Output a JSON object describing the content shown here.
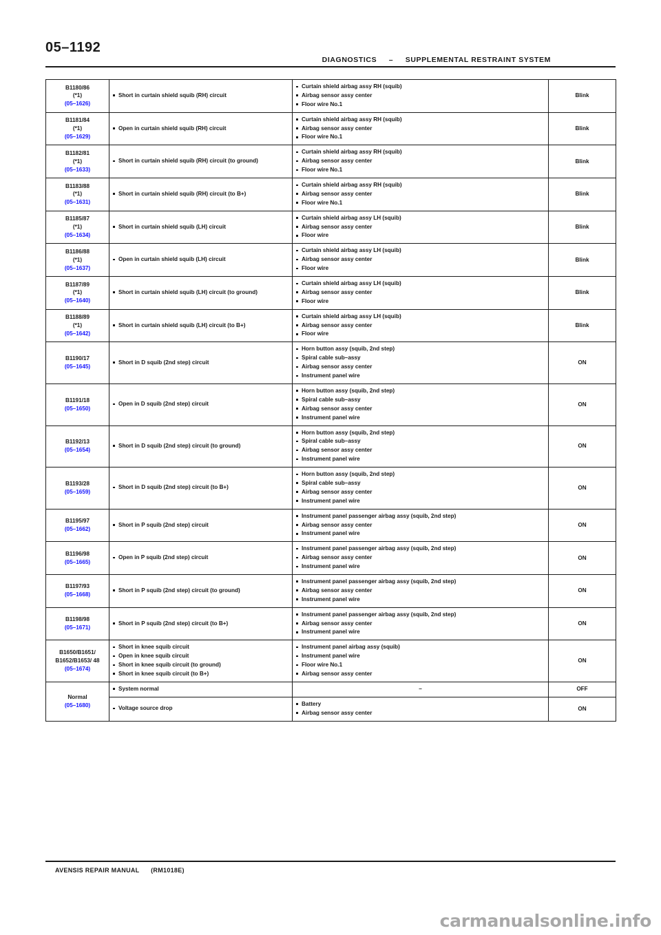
{
  "header": {
    "page_number": "05–1192",
    "section": "DIAGNOSTICS",
    "separator": "–",
    "system": "SUPPLEMENTAL RESTRAINT SYSTEM"
  },
  "footer": {
    "manual": "AVENSIS REPAIR MANUAL",
    "code": "(RM1018E)"
  },
  "watermark": "carmanualsonline.info",
  "table": {
    "rows": [
      {
        "dtc": "B1180/86",
        "note": "(*1)",
        "ref": "(05–1626)",
        "trouble": [
          "Short in curtain shield squib (RH) circuit"
        ],
        "suspect": [
          "Curtain shield airbag assy RH (squib)",
          "Airbag sensor assy center",
          "Floor wire No.1"
        ],
        "warning": "Blink"
      },
      {
        "dtc": "B1181/84",
        "note": "(*1)",
        "ref": "(05–1629)",
        "trouble": [
          "Open in curtain shield squib (RH) circuit"
        ],
        "suspect": [
          "Curtain shield airbag assy RH (squib)",
          "Airbag sensor assy center",
          "Floor wire No.1"
        ],
        "warning": "Blink"
      },
      {
        "dtc": "B1182/81",
        "note": "(*1)",
        "ref": "(05–1633)",
        "trouble": [
          "Short in curtain shield squib (RH) circuit (to ground)"
        ],
        "suspect": [
          "Curtain shield airbag assy RH (squib)",
          "Airbag sensor assy center",
          "Floor wire No.1"
        ],
        "warning": "Blink"
      },
      {
        "dtc": "B1183/88",
        "note": "(*1)",
        "ref": "(05–1631)",
        "trouble": [
          "Short in curtain shield squib (RH) circuit (to B+)"
        ],
        "suspect": [
          "Curtain shield airbag assy RH (squib)",
          "Airbag sensor assy center",
          "Floor wire No.1"
        ],
        "warning": "Blink"
      },
      {
        "dtc": "B1185/87",
        "note": "(*1)",
        "ref": "(05–1634)",
        "trouble": [
          "Short in curtain shield squib (LH) circuit"
        ],
        "suspect": [
          "Curtain shield airbag assy LH (squib)",
          "Airbag sensor assy center",
          "Floor wire"
        ],
        "warning": "Blink"
      },
      {
        "dtc": "B1186/88",
        "note": "(*1)",
        "ref": "(05–1637)",
        "trouble": [
          "Open in curtain shield squib (LH) circuit"
        ],
        "suspect": [
          "Curtain shield airbag assy LH (squib)",
          "Airbag sensor assy center",
          "Floor wire"
        ],
        "warning": "Blink"
      },
      {
        "dtc": "B1187/89",
        "note": "(*1)",
        "ref": "(05–1640)",
        "trouble": [
          "Short in curtain shield squib (LH) circuit (to ground)"
        ],
        "suspect": [
          "Curtain shield airbag assy LH (squib)",
          "Airbag sensor assy center",
          "Floor wire"
        ],
        "warning": "Blink"
      },
      {
        "dtc": "B1188/89",
        "note": "(*1)",
        "ref": "(05–1642)",
        "trouble": [
          "Short in curtain shield squib (LH) circuit (to B+)"
        ],
        "suspect": [
          "Curtain shield airbag assy LH (squib)",
          "Airbag sensor assy center",
          "Floor wire"
        ],
        "warning": "Blink"
      },
      {
        "dtc": "B1190/17",
        "note": "",
        "ref": "(05–1645)",
        "trouble": [
          "Short in D squib (2nd step) circuit"
        ],
        "suspect": [
          "Horn button assy (squib, 2nd step)",
          "Spiral cable sub–assy",
          "Airbag sensor assy center",
          "Instrument panel wire"
        ],
        "warning": "ON"
      },
      {
        "dtc": "B1191/18",
        "note": "",
        "ref": "(05–1650)",
        "trouble": [
          "Open in D squib (2nd step) circuit"
        ],
        "suspect": [
          "Horn button assy (squib, 2nd step)",
          "Spiral cable sub–assy",
          "Airbag sensor assy center",
          "Instrument panel wire"
        ],
        "warning": "ON"
      },
      {
        "dtc": "B1192/13",
        "note": "",
        "ref": "(05–1654)",
        "trouble": [
          "Short in D squib (2nd step) circuit (to ground)"
        ],
        "suspect": [
          "Horn button assy (squib, 2nd step)",
          "Spiral cable sub–assy",
          "Airbag sensor assy center",
          "Instrument panel wire"
        ],
        "warning": "ON"
      },
      {
        "dtc": "B1193/28",
        "note": "",
        "ref": "(05–1659)",
        "trouble": [
          "Short in D squib (2nd step) circuit (to B+)"
        ],
        "suspect": [
          "Horn button assy (squib, 2nd step)",
          "Spiral cable sub–assy",
          "Airbag sensor assy center",
          "Instrument panel wire"
        ],
        "warning": "ON"
      },
      {
        "dtc": "B1195/97",
        "note": "",
        "ref": "(05–1662)",
        "trouble": [
          "Short in P squib (2nd step) circuit"
        ],
        "suspect": [
          "Instrument panel passenger airbag assy (squib, 2nd step)",
          "Airbag sensor assy center",
          "Instrument panel wire"
        ],
        "warning": "ON"
      },
      {
        "dtc": "B1196/98",
        "note": "",
        "ref": "(05–1665)",
        "trouble": [
          "Open in P squib (2nd step) circuit"
        ],
        "suspect": [
          "Instrument panel passenger airbag assy (squib, 2nd step)",
          "Airbag sensor assy center",
          "Instrument panel wire"
        ],
        "warning": "ON"
      },
      {
        "dtc": "B1197/93",
        "note": "",
        "ref": "(05–1668)",
        "trouble": [
          "Short in P squib (2nd step) circuit (to ground)"
        ],
        "suspect": [
          "Instrument panel passenger airbag assy (squib, 2nd step)",
          "Airbag sensor assy center",
          "Instrument panel wire"
        ],
        "warning": "ON"
      },
      {
        "dtc": "B1198/98",
        "note": "",
        "ref": "(05–1671)",
        "trouble": [
          "Short in P squib (2nd step) circuit (to B+)"
        ],
        "suspect": [
          "Instrument panel passenger airbag assy (squib, 2nd step)",
          "Airbag sensor assy center",
          "Instrument panel wire"
        ],
        "warning": "ON"
      },
      {
        "dtc": "B1650/B1651/ B1652/B1653/ 48",
        "note": "",
        "ref": "(05–1674)",
        "trouble": [
          "Short in knee squib circuit",
          "Open in knee squib circuit",
          "Short in knee squib circuit (to ground)",
          "Short in knee squib circuit (to B+)"
        ],
        "suspect": [
          "Instrument panel airbag assy (squib)",
          "Instrument panel wire",
          "Floor wire No.1",
          "Airbag sensor assy center"
        ],
        "warning": "ON"
      },
      {
        "dtc": "Normal",
        "note": "",
        "ref": "(05–1680)",
        "trouble": [
          "System normal"
        ],
        "suspect_plain": "–",
        "warning": "OFF",
        "rowspan_dtc": 2
      },
      {
        "dtc": "",
        "note": "",
        "ref": "",
        "trouble": [
          "Voltage source drop"
        ],
        "suspect": [
          "Battery",
          "Airbag sensor assy center"
        ],
        "warning": "ON",
        "skip_dtc": true
      }
    ]
  }
}
